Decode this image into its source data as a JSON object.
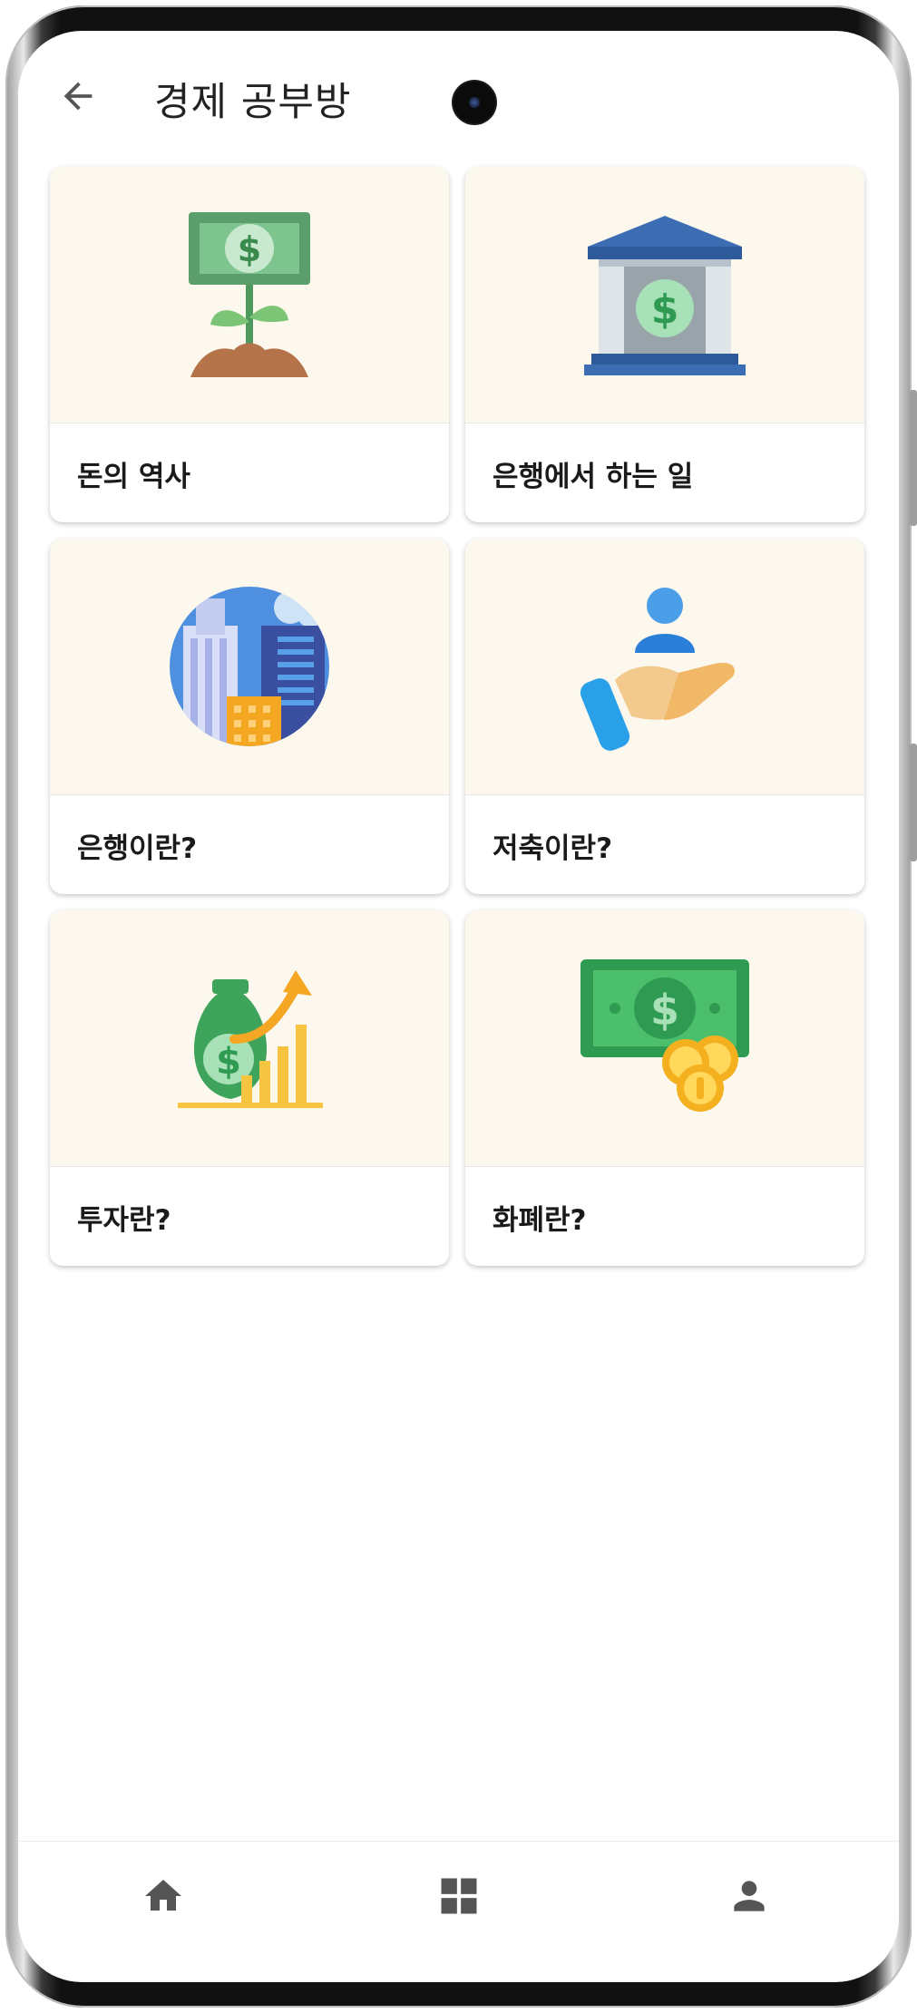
{
  "header": {
    "back_icon": "arrow-left-icon",
    "title": "경제 공부방"
  },
  "cards": [
    {
      "label": "돈의 역사",
      "icon": "money-plant-icon"
    },
    {
      "label": "은행에서 하는 일",
      "icon": "bank-building-icon"
    },
    {
      "label": "은행이란?",
      "icon": "city-buildings-icon"
    },
    {
      "label": "저축이란?",
      "icon": "hand-person-icon"
    },
    {
      "label": "투자란?",
      "icon": "money-bag-growth-icon"
    },
    {
      "label": "화폐란?",
      "icon": "banknote-coins-icon"
    }
  ],
  "bottom_nav": {
    "items": [
      {
        "icon": "home-icon"
      },
      {
        "icon": "grid-icon"
      },
      {
        "icon": "person-icon"
      }
    ]
  },
  "colors": {
    "card_image_bg": "#fcf8ee",
    "icon_gray": "#555555",
    "money_green": "#3fa45b",
    "bank_blue": "#3c6db3"
  }
}
